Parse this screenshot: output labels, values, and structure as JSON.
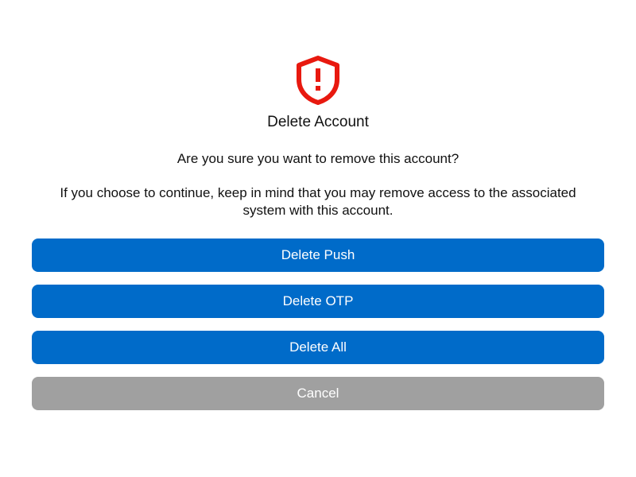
{
  "dialog": {
    "icon": "shield-alert-icon",
    "title": "Delete Account",
    "question": "Are you sure you want to remove this account?",
    "message": "If you choose to continue, keep in mind that you may remove access to the associated system with this account.",
    "buttons": {
      "delete_push": "Delete Push",
      "delete_otp": "Delete OTP",
      "delete_all": "Delete All",
      "cancel": "Cancel"
    }
  },
  "colors": {
    "primary": "#006BC9",
    "cancel": "#A0A0A0",
    "danger": "#E8190F"
  }
}
